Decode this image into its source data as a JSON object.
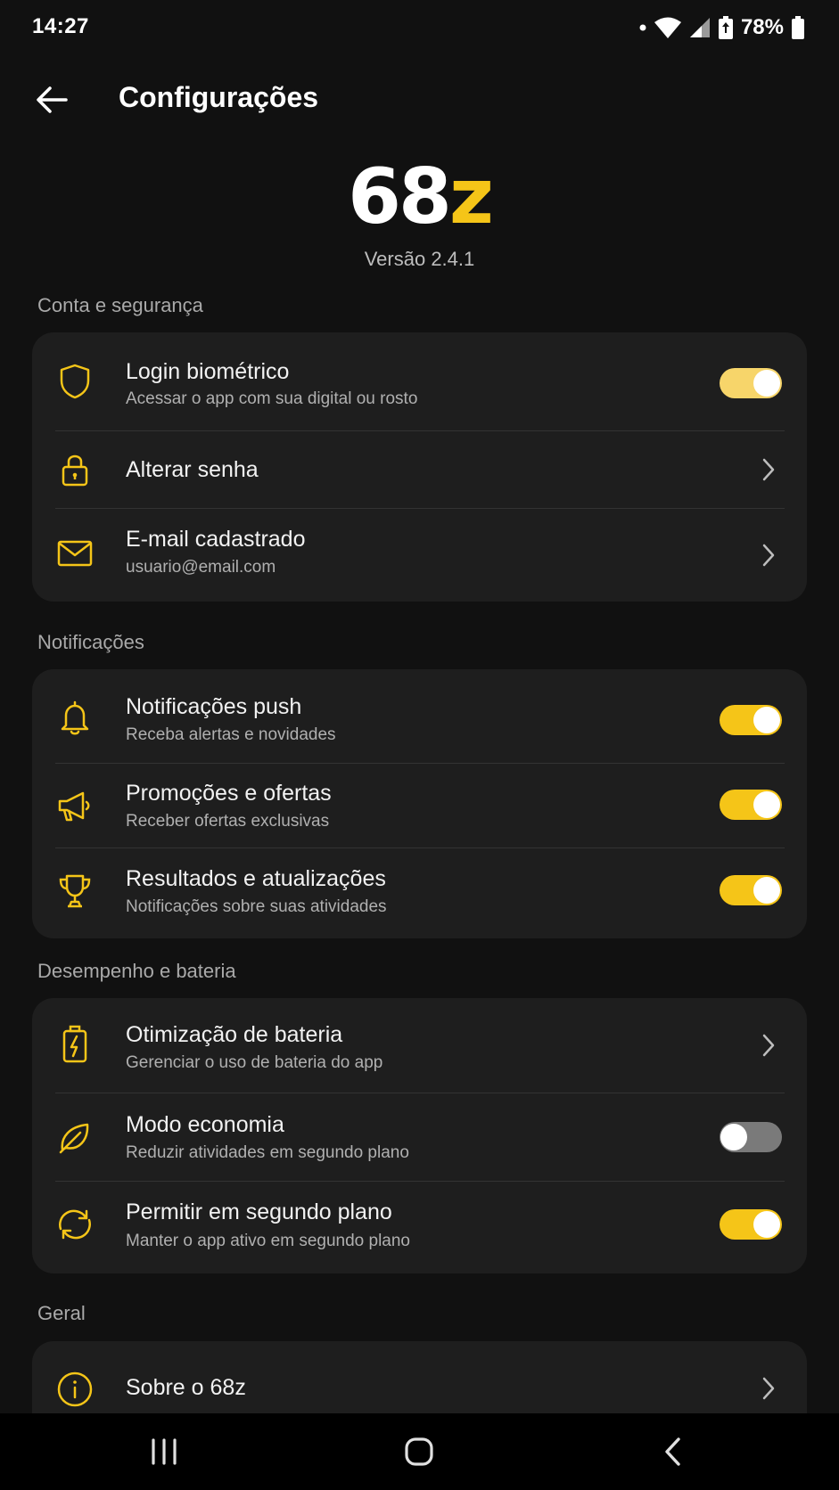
{
  "status_bar": {
    "time": "14:27",
    "battery_text": "78%",
    "icons": [
      "dot-icon",
      "wifi-icon",
      "signal-icon",
      "battery-saver-icon",
      "battery-icon"
    ]
  },
  "app_bar": {
    "title": "Configurações",
    "back_icon": "arrow-left-icon"
  },
  "brand": {
    "logo_number": "68",
    "logo_letter": "z",
    "version": "Versão 2.4.1",
    "accent_color": "#f5c518"
  },
  "sections": {
    "account": {
      "title": "Conta e segurança",
      "items": [
        {
          "icon": "shield-icon",
          "title": "Login biométrico",
          "subtitle": "Acessar o app com sua digital ou rosto",
          "control": "toggle",
          "on": true
        },
        {
          "icon": "lock-icon",
          "title": "Alterar senha",
          "control": "chevron"
        },
        {
          "icon": "mail-icon",
          "title": "E-mail cadastrado",
          "subtitle": "usuario@email.com",
          "control": "chevron"
        }
      ]
    },
    "notifications": {
      "title": "Notificações",
      "items": [
        {
          "icon": "bell-icon",
          "title": "Notificações push",
          "subtitle": "Receba alertas e novidades",
          "control": "toggle",
          "on": true
        },
        {
          "icon": "megaphone-icon",
          "title": "Promoções e ofertas",
          "subtitle": "Receber ofertas exclusivas",
          "control": "toggle",
          "on": true
        },
        {
          "icon": "trophy-icon",
          "title": "Resultados e atualizações",
          "subtitle": "Notificações sobre suas atividades",
          "control": "toggle",
          "on": true
        }
      ]
    },
    "performance": {
      "title": "Desempenho e bateria",
      "items": [
        {
          "icon": "battery-charging-icon",
          "title": "Otimização de bateria",
          "subtitle": "Gerenciar o uso de bateria do app",
          "control": "chevron"
        },
        {
          "icon": "leaf-icon",
          "title": "Modo economia",
          "subtitle": "Reduzir atividades em segundo plano",
          "control": "toggle",
          "on": false
        },
        {
          "icon": "refresh-icon",
          "title": "Permitir em segundo plano",
          "subtitle": "Manter o app ativo em segundo plano",
          "control": "toggle",
          "on": true
        }
      ]
    },
    "general": {
      "title": "Geral",
      "items": [
        {
          "icon": "info-icon",
          "title": "Sobre o 68z",
          "control": "chevron"
        }
      ]
    }
  },
  "nav_bar": {
    "buttons": [
      "recents-icon",
      "home-icon",
      "back-icon"
    ]
  }
}
